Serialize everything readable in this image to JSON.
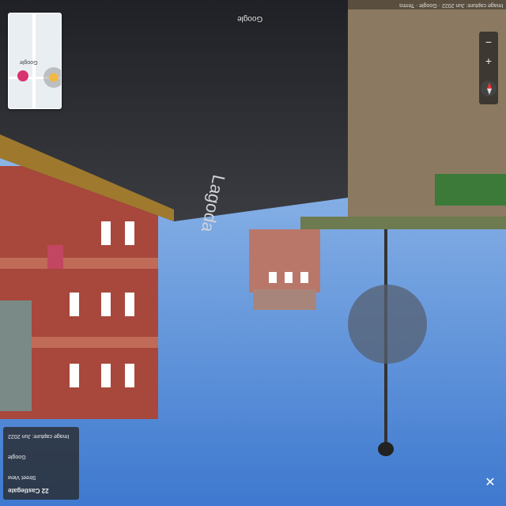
{
  "scene": {
    "road_marking_word": "Lagoda",
    "sky_color": "#4f86d6",
    "road_color": "#2b2d33",
    "brick_color": "#a8473c",
    "stone_color": "#8b7a61"
  },
  "top_bar": {
    "text": "Image capture: Jun 2022 · Google · Terms"
  },
  "street_label": "Google",
  "minimap": {
    "label": "Google",
    "accent": "#d8336e"
  },
  "controls": {
    "zoom_in": "+",
    "zoom_out": "−"
  },
  "info_card": {
    "title": "22 Castlegate",
    "subtitle": "Street View",
    "date": "Image capture: Jun 2022",
    "app": "Google"
  },
  "close_label": "✕"
}
